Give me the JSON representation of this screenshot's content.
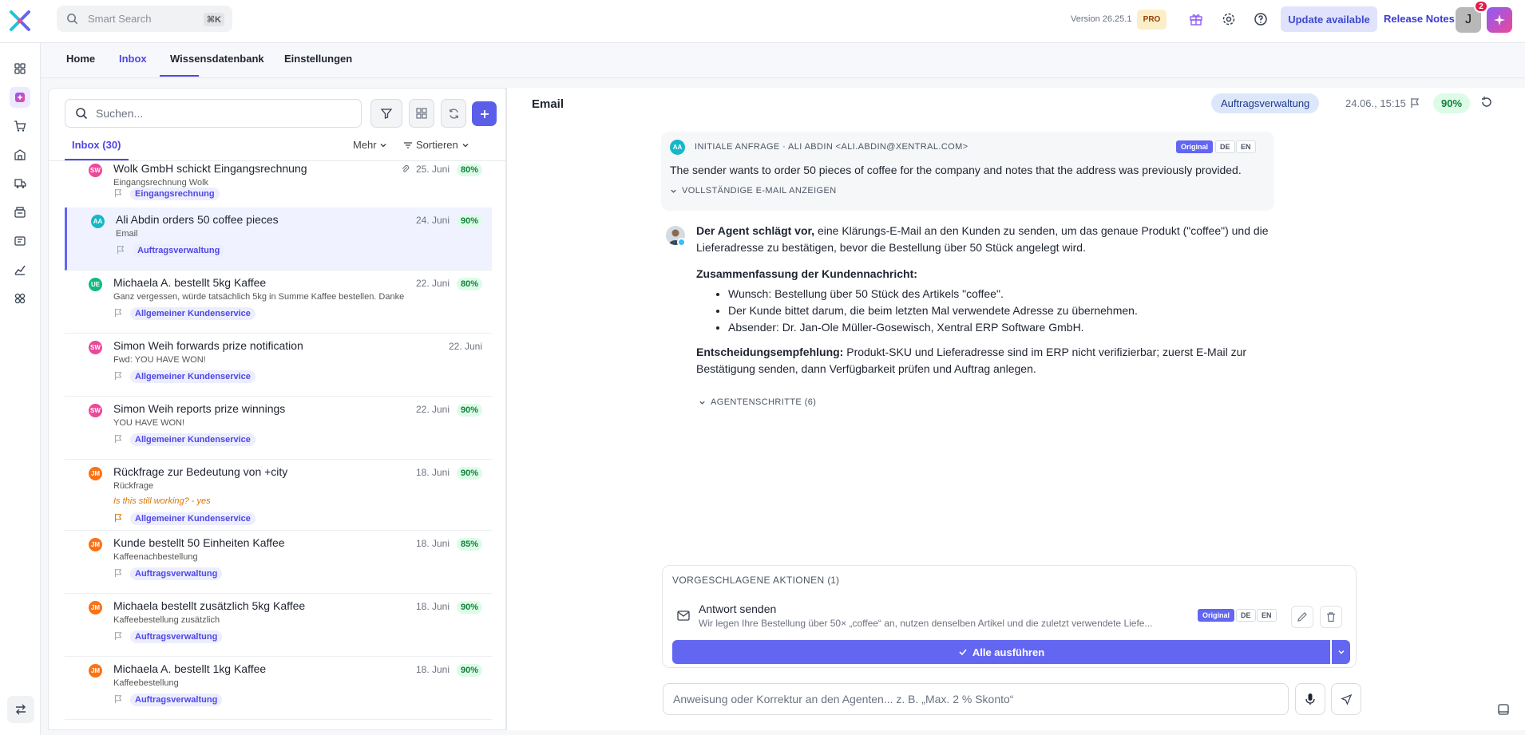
{
  "topbar": {
    "search_placeholder": "Smart Search",
    "search_shortcut": "⌘K",
    "version": "Version 26.25.1",
    "plan_badge": "PRO",
    "update_label": "Update available",
    "release_notes_label": "Release Notes",
    "user_initial": "J",
    "notification_count": "2"
  },
  "nav": {
    "tabs": [
      "Home",
      "Inbox",
      "Wissensdatenbank",
      "Einstellungen"
    ],
    "active_tab": "Inbox"
  },
  "inbox": {
    "search_placeholder": "Suchen...",
    "tab_label": "Inbox (30)",
    "more_label": "Mehr",
    "sort_label": "Sortieren",
    "items": [
      {
        "initials": "SW",
        "avatar_color": "#ec4899",
        "title": "Wolk GmbH schickt Eingangsrechnung",
        "date": "25. Juni",
        "pct": "80%",
        "subtitle": "Eingangsrechnung Wolk",
        "note": "",
        "tag": "Eingangsrechnung",
        "attachment": true
      },
      {
        "initials": "AA",
        "avatar_color": "#14b8c8",
        "title": "Ali Abdin orders 50 coffee pieces",
        "date": "24. Juni",
        "pct": "90%",
        "subtitle": "Email",
        "note": "",
        "tag": "Auftragsverwaltung",
        "attachment": false
      },
      {
        "initials": "UE",
        "avatar_color": "#10b981",
        "title": "Michaela A. bestellt 5kg Kaffee",
        "date": "22. Juni",
        "pct": "80%",
        "subtitle": "Ganz vergessen, würde tatsächlich 5kg in Summe Kaffee bestellen. Danke",
        "note": "",
        "tag": "Allgemeiner Kundenservice",
        "attachment": false
      },
      {
        "initials": "SW",
        "avatar_color": "#ec4899",
        "title": "Simon Weih forwards prize notification",
        "date": "22. Juni",
        "pct": "",
        "subtitle": "Fwd: YOU HAVE WON!",
        "note": "",
        "tag": "Allgemeiner Kundenservice",
        "attachment": false
      },
      {
        "initials": "SW",
        "avatar_color": "#ec4899",
        "title": "Simon Weih reports prize winnings",
        "date": "22. Juni",
        "pct": "90%",
        "subtitle": "YOU HAVE WON!",
        "note": "",
        "tag": "Allgemeiner Kundenservice",
        "attachment": false
      },
      {
        "initials": "JM",
        "avatar_color": "#f97316",
        "title": "Rückfrage zur Bedeutung von +city",
        "date": "18. Juni",
        "pct": "90%",
        "subtitle": "Rückfrage",
        "note": "Is this still working? - yes",
        "tag": "Allgemeiner Kundenservice",
        "attachment": false
      },
      {
        "initials": "JM",
        "avatar_color": "#f97316",
        "title": "Kunde bestellt 50 Einheiten Kaffee",
        "date": "18. Juni",
        "pct": "85%",
        "subtitle": "Kaffeenachbestellung",
        "note": "",
        "tag": "Auftragsverwaltung",
        "attachment": false
      },
      {
        "initials": "JM",
        "avatar_color": "#f97316",
        "title": "Michaela bestellt zusätzlich 5kg Kaffee",
        "date": "18. Juni",
        "pct": "90%",
        "subtitle": "Kaffeebestellung zusätzlich",
        "note": "",
        "tag": "Auftragsverwaltung",
        "attachment": false
      },
      {
        "initials": "JM",
        "avatar_color": "#f97316",
        "title": "Michaela A. bestellt 1kg Kaffee",
        "date": "18. Juni",
        "pct": "90%",
        "subtitle": "Kaffeebestellung",
        "note": "",
        "tag": "Auftragsverwaltung",
        "attachment": false
      }
    ]
  },
  "detail": {
    "title": "Email",
    "category": "Auftragsverwaltung",
    "datetime": "24.06., 15:15",
    "confidence": "90%",
    "request": {
      "initials": "AA",
      "header": "INITIALE ANFRAGE · ALI ABDIN <ALI.ABDIN@XENTRAL.COM>",
      "lang_original": "Original",
      "lang_de": "DE",
      "lang_en": "EN",
      "summary": "The sender wants to order 50 pieces of coffee for the company and notes that the address was previously provided.",
      "show_full": "VOLLSTÄNDIGE E-MAIL ANZEIGEN"
    },
    "agent": {
      "lead_bold": "Der Agent schlägt vor,",
      "lead_text": " eine Klärungs-E-Mail an den Kunden zu senden, um das genaue Produkt (\"coffee\") und die Lieferadresse zu bestätigen, bevor die Bestellung über 50 Stück angelegt wird.",
      "summary_heading": "Zusammenfassung der Kundennachricht:",
      "bullets": [
        "Wunsch: Bestellung über 50 Stück des Artikels \"coffee\".",
        "Der Kunde bittet darum, die beim letzten Mal verwendete Adresse zu übernehmen.",
        "Absender: Dr. Jan-Ole Müller-Gosewisch, Xentral ERP Software GmbH."
      ],
      "decision_bold": "Entscheidungsempfehlung:",
      "decision_text": " Produkt-SKU und Lieferadresse sind im ERP nicht verifizierbar; zuerst E-Mail zur Bestätigung senden, dann Verfügbarkeit prüfen und Auftrag anlegen.",
      "steps_label": "AGENTENSCHRITTE (6)"
    },
    "actions": {
      "heading": "VORGESCHLAGENE AKTIONEN",
      "count": "(1)",
      "item_title": "Antwort senden",
      "item_desc": "Wir legen Ihre Bestellung über 50× „coffee“ an, nutzen denselben Artikel und die zuletzt verwendete Liefe...",
      "lang_original": "Original",
      "lang_de": "DE",
      "lang_en": "EN",
      "run_all": "Alle ausführen"
    },
    "input_placeholder": "Anweisung oder Korrektur an den Agenten... z. B. „Max. 2 % Skonto“"
  }
}
